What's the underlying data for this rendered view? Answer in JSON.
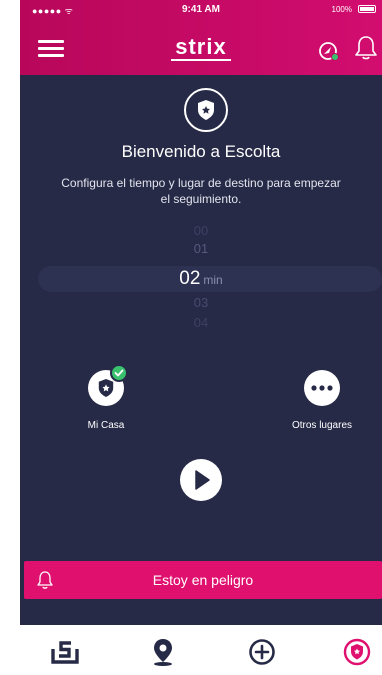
{
  "status_bar": {
    "signal": "●●●●● ᯤ",
    "time": "9:41 AM",
    "battery": "100%"
  },
  "header": {
    "logo": "strix",
    "icons": [
      "menu-icon",
      "navigation-icon",
      "bell-icon"
    ],
    "accent_color": "#d20d6f"
  },
  "escolta": {
    "title": "Bienvenido a Escolta",
    "subtitle": "Configura el tiempo y lugar de destino para empezar el seguimiento.",
    "picker": {
      "values": [
        "00",
        "01",
        "02",
        "03",
        "04"
      ],
      "selected": "02",
      "unit": "min"
    },
    "destinations": [
      {
        "label": "Mi Casa",
        "icon": "shield-icon",
        "selected": true
      },
      {
        "label": "Otros lugares",
        "icon": "more-icon",
        "selected": false
      }
    ],
    "start_icon": "play-icon"
  },
  "danger": {
    "label": "Estoy en peligro",
    "color": "#e0106f"
  },
  "tabbar": {
    "items": [
      {
        "name": "strix",
        "icon": "strix-icon",
        "active": false
      },
      {
        "name": "location",
        "icon": "location-pin-icon",
        "active": false
      },
      {
        "name": "add",
        "icon": "add-circle-icon",
        "active": false
      },
      {
        "name": "escolta",
        "icon": "escolta-shield-icon",
        "active": true
      }
    ],
    "active_color": "#e0106f"
  }
}
